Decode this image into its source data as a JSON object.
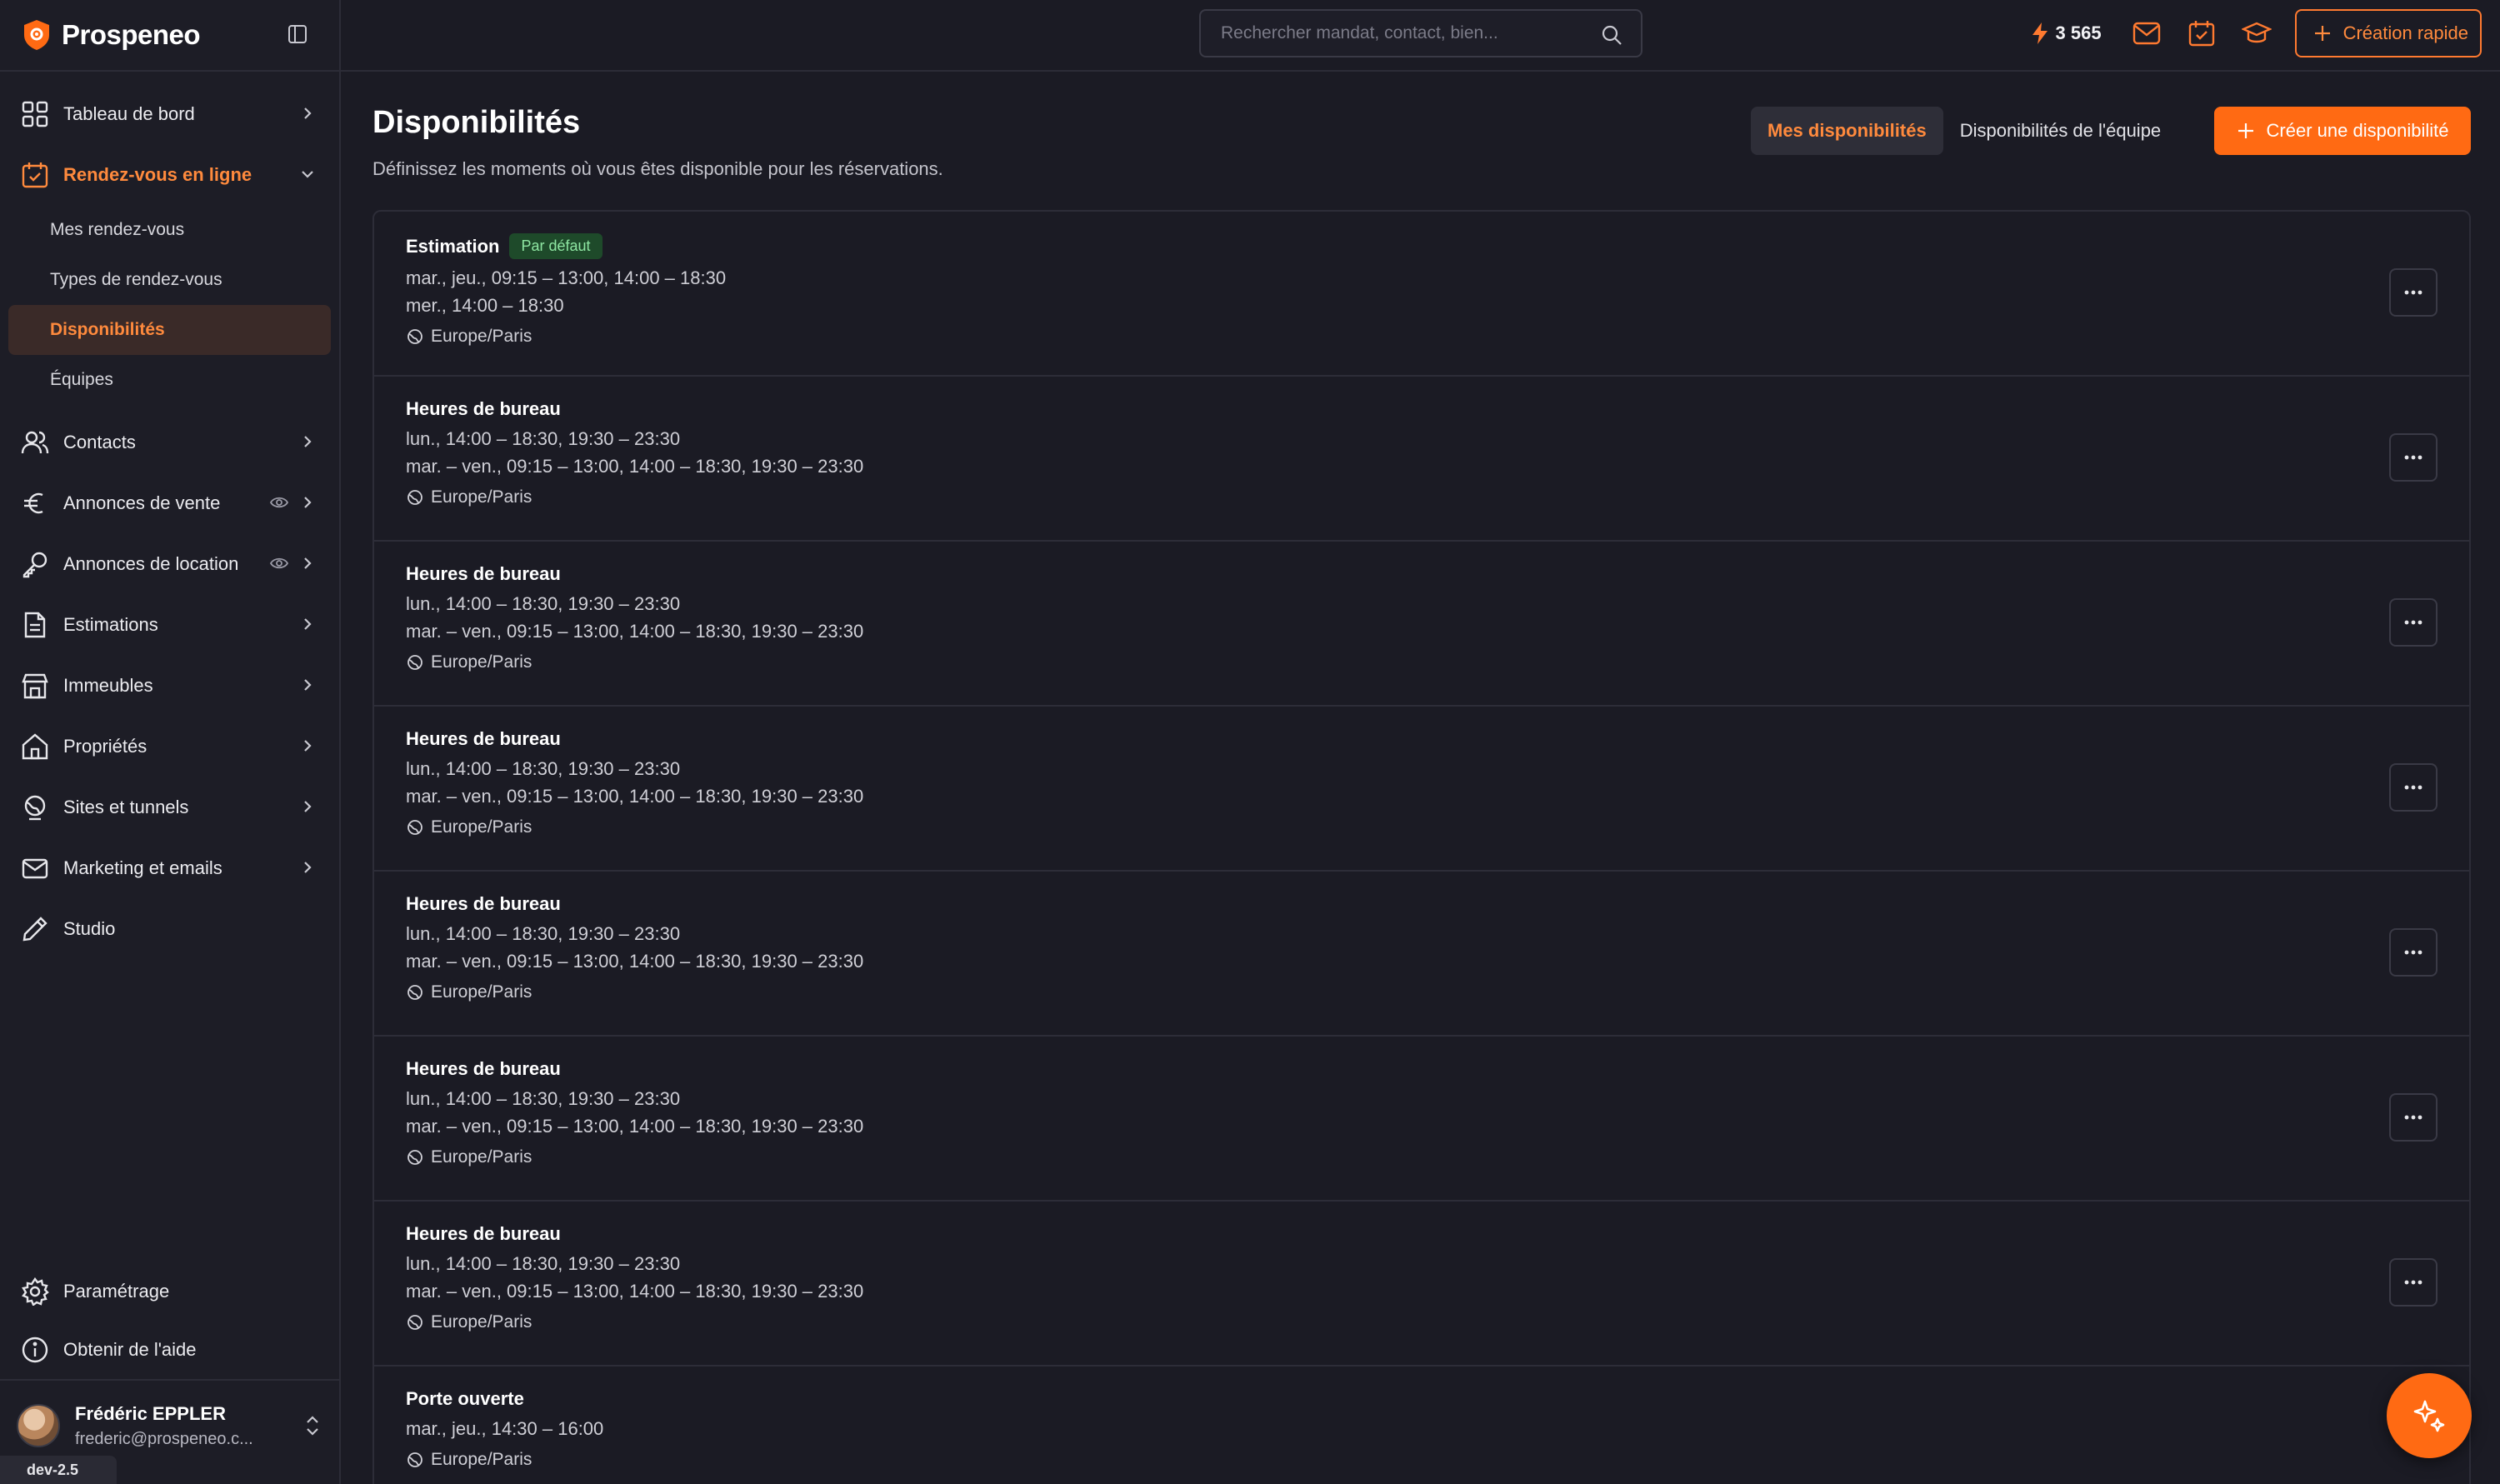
{
  "brand": {
    "name": "Prospeneo"
  },
  "search": {
    "placeholder": "Rechercher mandat, contact, bien..."
  },
  "topbar": {
    "credits": "3 565",
    "quick_create": "Création rapide"
  },
  "sidebar": {
    "items": [
      {
        "key": "tableau-de-bord",
        "label": "Tableau de bord"
      },
      {
        "key": "rendez-vous",
        "label": "Rendez-vous en ligne"
      },
      {
        "key": "contacts",
        "label": "Contacts"
      },
      {
        "key": "annonces-vente",
        "label": "Annonces de vente"
      },
      {
        "key": "annonces-location",
        "label": "Annonces de location"
      },
      {
        "key": "estimations",
        "label": "Estimations"
      },
      {
        "key": "immeubles",
        "label": "Immeubles"
      },
      {
        "key": "proprietes",
        "label": "Propriétés"
      },
      {
        "key": "sites-tunnels",
        "label": "Sites et tunnels"
      },
      {
        "key": "marketing",
        "label": "Marketing et emails"
      },
      {
        "key": "studio",
        "label": "Studio"
      }
    ],
    "subitems": [
      {
        "label": "Mes rendez-vous"
      },
      {
        "label": "Types de rendez-vous"
      },
      {
        "label": "Disponibilités"
      },
      {
        "label": "Équipes"
      }
    ],
    "bottom": [
      {
        "label": "Paramétrage"
      },
      {
        "label": "Obtenir de l'aide"
      }
    ],
    "user": {
      "name": "Frédéric EPPLER",
      "email": "frederic@prospeneo.c..."
    },
    "version": "dev-2.5"
  },
  "page": {
    "title": "Disponibilités",
    "subtitle": "Définissez les moments où vous êtes disponible pour les réservations.",
    "tabs": [
      "Mes disponibilités",
      "Disponibilités de l'équipe"
    ],
    "create_button": "Créer une disponibilité"
  },
  "availabilities": [
    {
      "title": "Estimation",
      "badge": "Par défaut",
      "lines": [
        "mar., jeu., 09:15 – 13:00, 14:00 – 18:30",
        "mer., 14:00 – 18:30"
      ],
      "timezone": "Europe/Paris"
    },
    {
      "title": "Heures de bureau",
      "lines": [
        "lun., 14:00 – 18:30, 19:30 – 23:30",
        "mar. – ven., 09:15 – 13:00, 14:00 – 18:30, 19:30 – 23:30"
      ],
      "timezone": "Europe/Paris"
    },
    {
      "title": "Heures de bureau",
      "lines": [
        "lun., 14:00 – 18:30, 19:30 – 23:30",
        "mar. – ven., 09:15 – 13:00, 14:00 – 18:30, 19:30 – 23:30"
      ],
      "timezone": "Europe/Paris"
    },
    {
      "title": "Heures de bureau",
      "lines": [
        "lun., 14:00 – 18:30, 19:30 – 23:30",
        "mar. – ven., 09:15 – 13:00, 14:00 – 18:30, 19:30 – 23:30"
      ],
      "timezone": "Europe/Paris"
    },
    {
      "title": "Heures de bureau",
      "lines": [
        "lun., 14:00 – 18:30, 19:30 – 23:30",
        "mar. – ven., 09:15 – 13:00, 14:00 – 18:30, 19:30 – 23:30"
      ],
      "timezone": "Europe/Paris"
    },
    {
      "title": "Heures de bureau",
      "lines": [
        "lun., 14:00 – 18:30, 19:30 – 23:30",
        "mar. – ven., 09:15 – 13:00, 14:00 – 18:30, 19:30 – 23:30"
      ],
      "timezone": "Europe/Paris"
    },
    {
      "title": "Heures de bureau",
      "lines": [
        "lun., 14:00 – 18:30, 19:30 – 23:30",
        "mar. – ven., 09:15 – 13:00, 14:00 – 18:30, 19:30 – 23:30"
      ],
      "timezone": "Europe/Paris"
    },
    {
      "title": "Porte ouverte",
      "lines": [
        "mar., jeu., 14:30 – 16:00"
      ],
      "timezone": "Europe/Paris"
    }
  ],
  "colors": {
    "accent": "#ff6a13",
    "accent_text": "#ff8a3d",
    "background": "#1b1b24",
    "badge_bg": "#1e4a2a",
    "badge_text": "#8ee6a2"
  }
}
